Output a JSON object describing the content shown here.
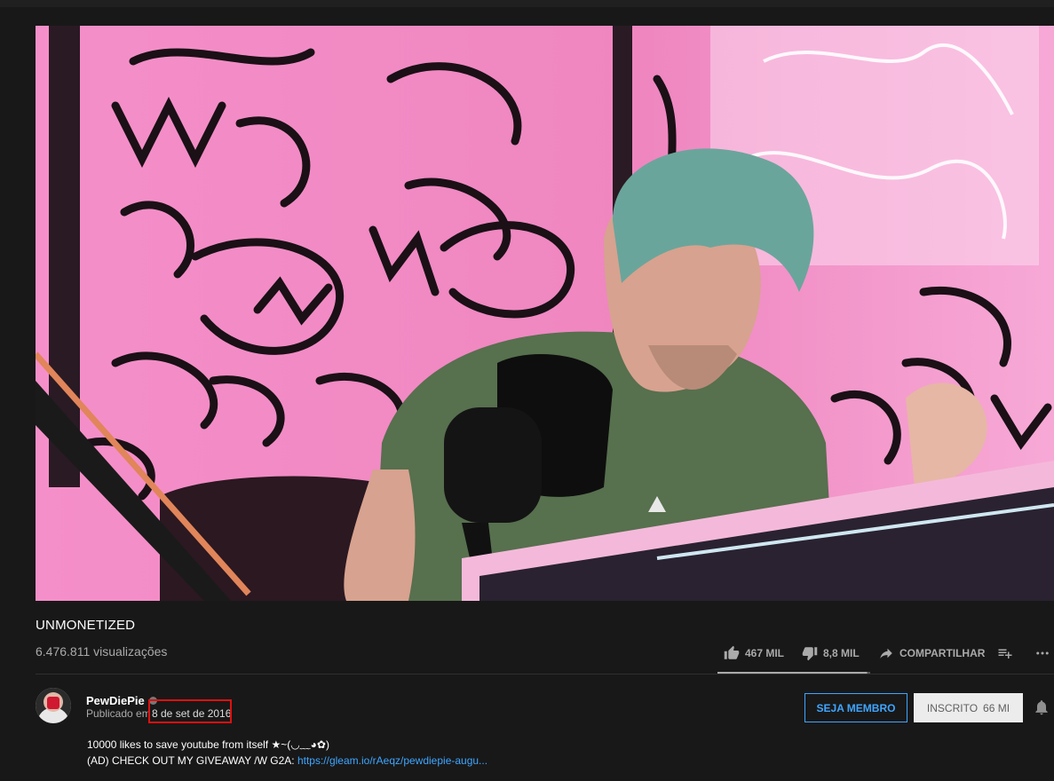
{
  "video": {
    "title": "UNMONETIZED",
    "views": "6.476.811 visualizações"
  },
  "actions": {
    "likes": "467 MIL",
    "dislikes": "8,8 MIL",
    "share": "COMPARTILHAR",
    "like_ratio": 0.98
  },
  "channel": {
    "name": "PewDiePie",
    "published_prefix": "Publicado em",
    "date": "8 de set de 2016"
  },
  "buttons": {
    "member": "SEJA MEMBRO",
    "subscribed": "INSCRITO",
    "sub_count": "66 MI"
  },
  "description": {
    "line1": "10000 likes to save youtube from itself ★~(◡﹏◕✿)",
    "line2_prefix": "(AD) CHECK OUT MY GIVEAWAY /W G2A: ",
    "link": "https://gleam.io/rAeqz/pewdiepie-augu..."
  },
  "colors": {
    "background": "#181818",
    "accent_blue": "#3ea6ff",
    "highlight_red": "#e01010"
  },
  "icons": [
    "like-icon",
    "dislike-icon",
    "share-icon",
    "save-to-playlist-icon",
    "more-icon",
    "verified-icon",
    "bell-icon"
  ]
}
